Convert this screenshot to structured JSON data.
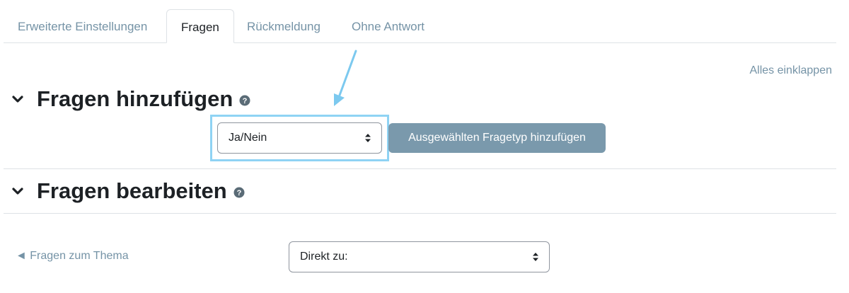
{
  "tabs": [
    {
      "label": "Erweiterte Einstellungen",
      "active": false
    },
    {
      "label": "Fragen",
      "active": true
    },
    {
      "label": "Rückmeldung",
      "active": false
    },
    {
      "label": "Ohne Antwort",
      "active": false
    }
  ],
  "collapse_all": "Alles einklappen",
  "add_section": {
    "title": "Fragen hinzufügen",
    "question_type_select": "Ja/Nein",
    "add_button": "Ausgewählten Fragetyp hinzufügen"
  },
  "edit_section": {
    "title": "Fragen bearbeiten"
  },
  "nav": {
    "prev_link": "◄ Fragen zum Thema",
    "jump_select": "Direkt zu:"
  },
  "colors": {
    "link": "#7593a6",
    "button": "#7a99ac",
    "highlight": "#8fd3f4"
  },
  "icons": [
    "chevron-down-icon",
    "help-icon",
    "select-caret-icon",
    "arrow-annotation"
  ]
}
